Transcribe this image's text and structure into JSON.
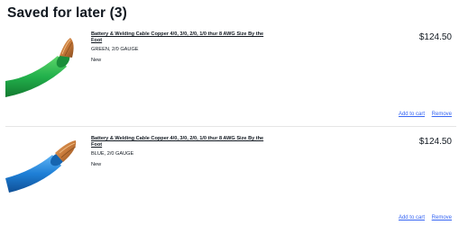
{
  "section": {
    "title": "Saved for later (3)"
  },
  "items": [
    {
      "title": "Battery & Welding Cable Copper 4/0, 3/0, 2/0, 1/0 thur 8 AWG Size By the Foot",
      "variant": "GREEN, 2/0 GAUGE",
      "condition": "New",
      "price": "$124.50",
      "add_to_cart": "Add to cart",
      "remove": "Remove",
      "cable_color": "#22b14c"
    },
    {
      "title": "Battery & Welding Cable Copper 4/0, 3/0, 2/0, 1/0 thur 8 AWG Size By the Foot",
      "variant": "BLUE, 2/0 GAUGE",
      "condition": "New",
      "price": "$124.50",
      "add_to_cart": "Add to cart",
      "remove": "Remove",
      "cable_color": "#1e7fd6"
    }
  ]
}
